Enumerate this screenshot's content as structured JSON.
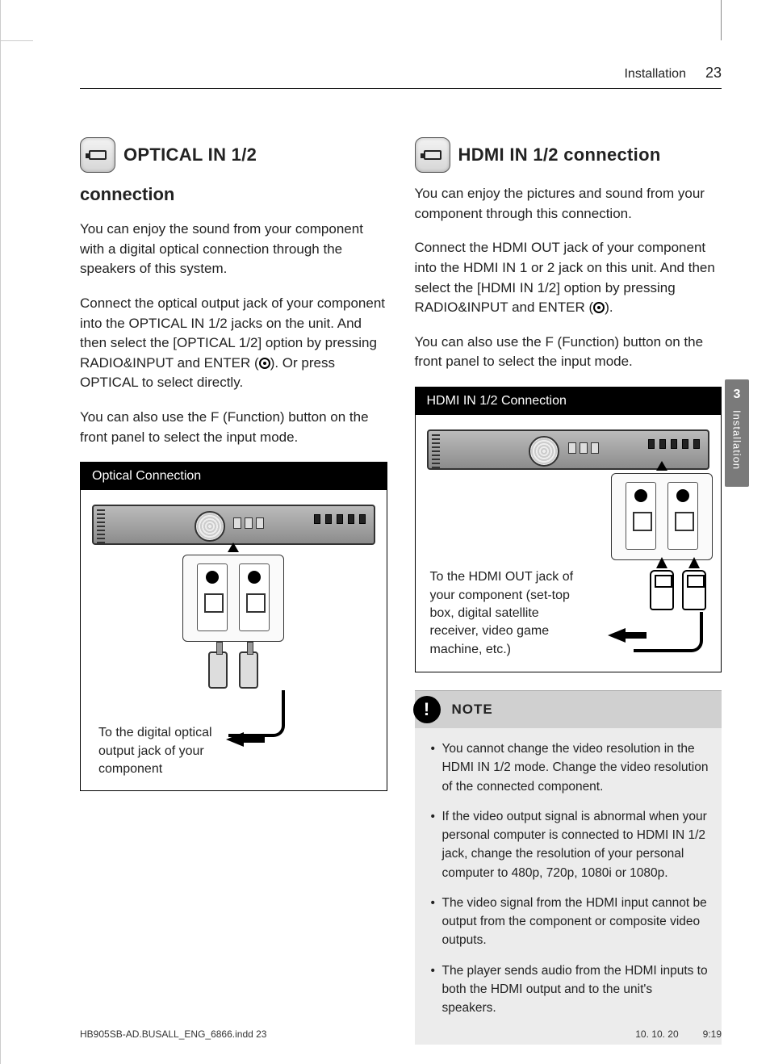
{
  "header": {
    "section": "Installation",
    "page_number": "23"
  },
  "side_tab": {
    "number": "3",
    "label": "Installation"
  },
  "left": {
    "heading_line1": "OPTICAL IN 1/2",
    "heading_line2": "connection",
    "para1": "You can enjoy the sound from your component with a digital optical connection through the speakers of this system.",
    "para2_a": "Connect the optical output jack of your component into the OPTICAL IN 1/2 jacks on the unit. And then select the [OPTICAL 1/2] option by pressing RADIO&INPUT and ENTER (",
    "para2_b": "). Or press OPTICAL to select directly.",
    "para3": "You can also use the F (Function) button on the front panel to select the input mode.",
    "diagram_title": "Optical Connection",
    "diagram_caption": "To the digital optical output jack of your component"
  },
  "right": {
    "heading": "HDMI IN 1/2 connection",
    "para1": "You can enjoy the pictures and sound  from your component through this connection.",
    "para2_a": "Connect the HDMI OUT jack of your component into the HDMI IN 1 or 2 jack on this unit. And then select the [HDMI IN 1/2] option by pressing RADIO&INPUT and ENTER (",
    "para2_b": ").",
    "para3": "You can also use the F (Function) button on the front panel to select the input mode.",
    "diagram_title": "HDMI IN 1/2 Connection",
    "diagram_caption": "To the HDMI OUT jack of your component (set-top box, digital satellite receiver, video game machine, etc.)",
    "note_label": "NOTE",
    "notes": [
      "You cannot change the video resolution in the HDMI IN 1/2 mode. Change the video resolution of the connected component.",
      "If the video output signal is abnormal when your personal computer is connected to HDMI IN 1/2 jack, change the resolution of your personal computer to 480p, 720p, 1080i or 1080p.",
      "The video signal from the HDMI input cannot be output from the component or composite video outputs.",
      "The player sends audio from the HDMI inputs to both the HDMI output and to the unit's speakers."
    ]
  },
  "footer": {
    "file": "HB905SB-AD.BUSALL_ENG_6866.indd   23",
    "date": "10. 10. 20",
    "time": "9:19"
  }
}
